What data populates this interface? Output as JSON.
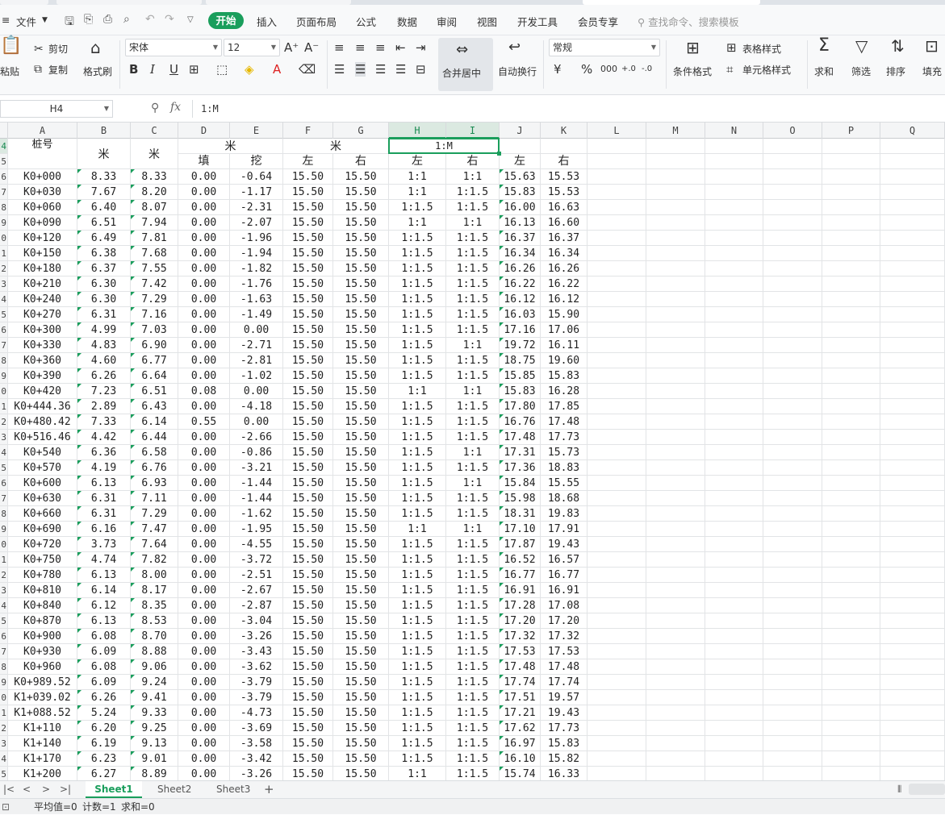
{
  "menu": {
    "file": "文件",
    "tabs": [
      "开始",
      "插入",
      "页面布局",
      "公式",
      "数据",
      "审阅",
      "视图",
      "开发工具",
      "会员专享"
    ],
    "search_placeholder": "查找命令、搜索模板"
  },
  "ribbon": {
    "paste": "粘贴",
    "cut": "剪切",
    "copy": "复制",
    "format_painter": "格式刷",
    "font_name": "宋体",
    "font_size": "12",
    "merge_center": "合并居中",
    "wrap_text": "自动换行",
    "number_format": "常规",
    "conditional_format": "条件格式",
    "table_style": "表格样式",
    "cell_style": "单元格样式",
    "sum": "求和",
    "filter": "筛选",
    "sort": "排序",
    "fill": "填充"
  },
  "formula_bar": {
    "name_box": "H4",
    "fx": "fx",
    "content": "1:M"
  },
  "columns": [
    "A",
    "B",
    "C",
    "D",
    "E",
    "F",
    "G",
    "H",
    "I",
    "J",
    "K",
    "L",
    "M",
    "N",
    "O",
    "P",
    "Q"
  ],
  "header_rows": {
    "row4": {
      "a": "桩号",
      "b": "米",
      "c": "米",
      "de": "米",
      "fg": "米",
      "hi": "1:M"
    },
    "row5": {
      "d": "填",
      "e": "挖",
      "f": "左",
      "g": "右",
      "h": "左",
      "i": "右",
      "j": "左",
      "k": "右"
    }
  },
  "row_numbers": [
    "4",
    "5",
    "6",
    "7",
    "8",
    "9",
    "0",
    "1",
    "2",
    "3",
    "4",
    "5",
    "6",
    "7",
    "8",
    "9",
    "0",
    "1",
    "2",
    "3",
    "4",
    "5",
    "6",
    "7",
    "8",
    "9",
    "0",
    "1",
    "2",
    "3",
    "4",
    "5",
    "6",
    "7",
    "8",
    "9",
    "0",
    "1",
    "2",
    "3",
    "4",
    "5"
  ],
  "rows": [
    [
      "K0+000",
      "8.33",
      "8.33",
      "0.00",
      "-0.64",
      "15.50",
      "15.50",
      "1:1",
      "1:1",
      "15.63",
      "15.53"
    ],
    [
      "K0+030",
      "7.67",
      "8.20",
      "0.00",
      "-1.17",
      "15.50",
      "15.50",
      "1:1",
      "1:1.5",
      "15.83",
      "15.53"
    ],
    [
      "K0+060",
      "6.40",
      "8.07",
      "0.00",
      "-2.31",
      "15.50",
      "15.50",
      "1:1.5",
      "1:1.5",
      "16.00",
      "16.63"
    ],
    [
      "K0+090",
      "6.51",
      "7.94",
      "0.00",
      "-2.07",
      "15.50",
      "15.50",
      "1:1",
      "1:1",
      "16.13",
      "16.60"
    ],
    [
      "K0+120",
      "6.49",
      "7.81",
      "0.00",
      "-1.96",
      "15.50",
      "15.50",
      "1:1.5",
      "1:1.5",
      "16.37",
      "16.37"
    ],
    [
      "K0+150",
      "6.38",
      "7.68",
      "0.00",
      "-1.94",
      "15.50",
      "15.50",
      "1:1.5",
      "1:1.5",
      "16.34",
      "16.34"
    ],
    [
      "K0+180",
      "6.37",
      "7.55",
      "0.00",
      "-1.82",
      "15.50",
      "15.50",
      "1:1.5",
      "1:1.5",
      "16.26",
      "16.26"
    ],
    [
      "K0+210",
      "6.30",
      "7.42",
      "0.00",
      "-1.76",
      "15.50",
      "15.50",
      "1:1.5",
      "1:1.5",
      "16.22",
      "16.22"
    ],
    [
      "K0+240",
      "6.30",
      "7.29",
      "0.00",
      "-1.63",
      "15.50",
      "15.50",
      "1:1.5",
      "1:1.5",
      "16.12",
      "16.12"
    ],
    [
      "K0+270",
      "6.31",
      "7.16",
      "0.00",
      "-1.49",
      "15.50",
      "15.50",
      "1:1.5",
      "1:1.5",
      "16.03",
      "15.90"
    ],
    [
      "K0+300",
      "4.99",
      "7.03",
      "0.00",
      "0.00",
      "15.50",
      "15.50",
      "1:1.5",
      "1:1.5",
      "17.16",
      "17.06"
    ],
    [
      "K0+330",
      "4.83",
      "6.90",
      "0.00",
      "-2.71",
      "15.50",
      "15.50",
      "1:1.5",
      "1:1",
      "19.72",
      "16.11"
    ],
    [
      "K0+360",
      "4.60",
      "6.77",
      "0.00",
      "-2.81",
      "15.50",
      "15.50",
      "1:1.5",
      "1:1.5",
      "18.75",
      "19.60"
    ],
    [
      "K0+390",
      "6.26",
      "6.64",
      "0.00",
      "-1.02",
      "15.50",
      "15.50",
      "1:1.5",
      "1:1.5",
      "15.85",
      "15.83"
    ],
    [
      "K0+420",
      "7.23",
      "6.51",
      "0.08",
      "0.00",
      "15.50",
      "15.50",
      "1:1",
      "1:1",
      "15.83",
      "16.28"
    ],
    [
      "K0+444.36",
      "2.89",
      "6.43",
      "0.00",
      "-4.18",
      "15.50",
      "15.50",
      "1:1.5",
      "1:1.5",
      "17.80",
      "17.85"
    ],
    [
      "K0+480.42",
      "7.33",
      "6.14",
      "0.55",
      "0.00",
      "15.50",
      "15.50",
      "1:1.5",
      "1:1.5",
      "16.76",
      "17.48"
    ],
    [
      "K0+516.46",
      "4.42",
      "6.44",
      "0.00",
      "-2.66",
      "15.50",
      "15.50",
      "1:1.5",
      "1:1.5",
      "17.48",
      "17.73"
    ],
    [
      "K0+540",
      "6.36",
      "6.58",
      "0.00",
      "-0.86",
      "15.50",
      "15.50",
      "1:1.5",
      "1:1",
      "17.31",
      "15.73"
    ],
    [
      "K0+570",
      "4.19",
      "6.76",
      "0.00",
      "-3.21",
      "15.50",
      "15.50",
      "1:1.5",
      "1:1.5",
      "17.36",
      "18.83"
    ],
    [
      "K0+600",
      "6.13",
      "6.93",
      "0.00",
      "-1.44",
      "15.50",
      "15.50",
      "1:1.5",
      "1:1",
      "15.84",
      "15.55"
    ],
    [
      "K0+630",
      "6.31",
      "7.11",
      "0.00",
      "-1.44",
      "15.50",
      "15.50",
      "1:1.5",
      "1:1.5",
      "15.98",
      "18.68"
    ],
    [
      "K0+660",
      "6.31",
      "7.29",
      "0.00",
      "-1.62",
      "15.50",
      "15.50",
      "1:1.5",
      "1:1.5",
      "18.31",
      "19.83"
    ],
    [
      "K0+690",
      "6.16",
      "7.47",
      "0.00",
      "-1.95",
      "15.50",
      "15.50",
      "1:1",
      "1:1",
      "17.10",
      "17.91"
    ],
    [
      "K0+720",
      "3.73",
      "7.64",
      "0.00",
      "-4.55",
      "15.50",
      "15.50",
      "1:1.5",
      "1:1.5",
      "17.87",
      "19.43"
    ],
    [
      "K0+750",
      "4.74",
      "7.82",
      "0.00",
      "-3.72",
      "15.50",
      "15.50",
      "1:1.5",
      "1:1.5",
      "16.52",
      "16.57"
    ],
    [
      "K0+780",
      "6.13",
      "8.00",
      "0.00",
      "-2.51",
      "15.50",
      "15.50",
      "1:1.5",
      "1:1.5",
      "16.77",
      "16.77"
    ],
    [
      "K0+810",
      "6.14",
      "8.17",
      "0.00",
      "-2.67",
      "15.50",
      "15.50",
      "1:1.5",
      "1:1.5",
      "16.91",
      "16.91"
    ],
    [
      "K0+840",
      "6.12",
      "8.35",
      "0.00",
      "-2.87",
      "15.50",
      "15.50",
      "1:1.5",
      "1:1.5",
      "17.28",
      "17.08"
    ],
    [
      "K0+870",
      "6.13",
      "8.53",
      "0.00",
      "-3.04",
      "15.50",
      "15.50",
      "1:1.5",
      "1:1.5",
      "17.20",
      "17.20"
    ],
    [
      "K0+900",
      "6.08",
      "8.70",
      "0.00",
      "-3.26",
      "15.50",
      "15.50",
      "1:1.5",
      "1:1.5",
      "17.32",
      "17.32"
    ],
    [
      "K0+930",
      "6.09",
      "8.88",
      "0.00",
      "-3.43",
      "15.50",
      "15.50",
      "1:1.5",
      "1:1.5",
      "17.53",
      "17.53"
    ],
    [
      "K0+960",
      "6.08",
      "9.06",
      "0.00",
      "-3.62",
      "15.50",
      "15.50",
      "1:1.5",
      "1:1.5",
      "17.48",
      "17.48"
    ],
    [
      "K0+989.52",
      "6.09",
      "9.24",
      "0.00",
      "-3.79",
      "15.50",
      "15.50",
      "1:1.5",
      "1:1.5",
      "17.74",
      "17.74"
    ],
    [
      "K1+039.02",
      "6.26",
      "9.41",
      "0.00",
      "-3.79",
      "15.50",
      "15.50",
      "1:1.5",
      "1:1.5",
      "17.51",
      "19.57"
    ],
    [
      "K1+088.52",
      "5.24",
      "9.33",
      "0.00",
      "-4.73",
      "15.50",
      "15.50",
      "1:1.5",
      "1:1.5",
      "17.21",
      "19.43"
    ],
    [
      "K1+110",
      "6.20",
      "9.25",
      "0.00",
      "-3.69",
      "15.50",
      "15.50",
      "1:1.5",
      "1:1.5",
      "17.62",
      "17.73"
    ],
    [
      "K1+140",
      "6.19",
      "9.13",
      "0.00",
      "-3.58",
      "15.50",
      "15.50",
      "1:1.5",
      "1:1.5",
      "16.97",
      "15.83"
    ],
    [
      "K1+170",
      "6.23",
      "9.01",
      "0.00",
      "-3.42",
      "15.50",
      "15.50",
      "1:1.5",
      "1:1.5",
      "16.10",
      "15.82"
    ],
    [
      "K1+200",
      "6.27",
      "8.89",
      "0.00",
      "-3.26",
      "15.50",
      "15.50",
      "1:1",
      "1:1.5",
      "15.74",
      "16.33"
    ]
  ],
  "sheets": [
    "Sheet1",
    "Sheet2",
    "Sheet3"
  ],
  "active_sheet": "Sheet1",
  "status": {
    "avg": "平均值=0",
    "count": "计数=1",
    "sum": "求和=0"
  },
  "colors": {
    "accent": "#1a9e5c"
  }
}
